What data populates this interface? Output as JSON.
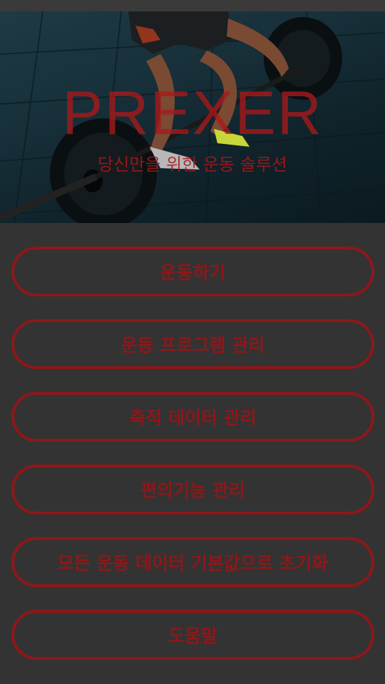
{
  "hero": {
    "title": "PREXER",
    "subtitle": "당신만을 위한 운동 솔루션"
  },
  "menu": {
    "items": [
      {
        "label": "운동하기"
      },
      {
        "label": "운동 프로그램 관리"
      },
      {
        "label": "축적 데이터 관리"
      },
      {
        "label": "편의기능 관리"
      },
      {
        "label": "모든 운동 데이터 기본값으로 초기화"
      },
      {
        "label": "도움말"
      }
    ]
  },
  "colors": {
    "background": "#333333",
    "accent": "#8e1719"
  }
}
